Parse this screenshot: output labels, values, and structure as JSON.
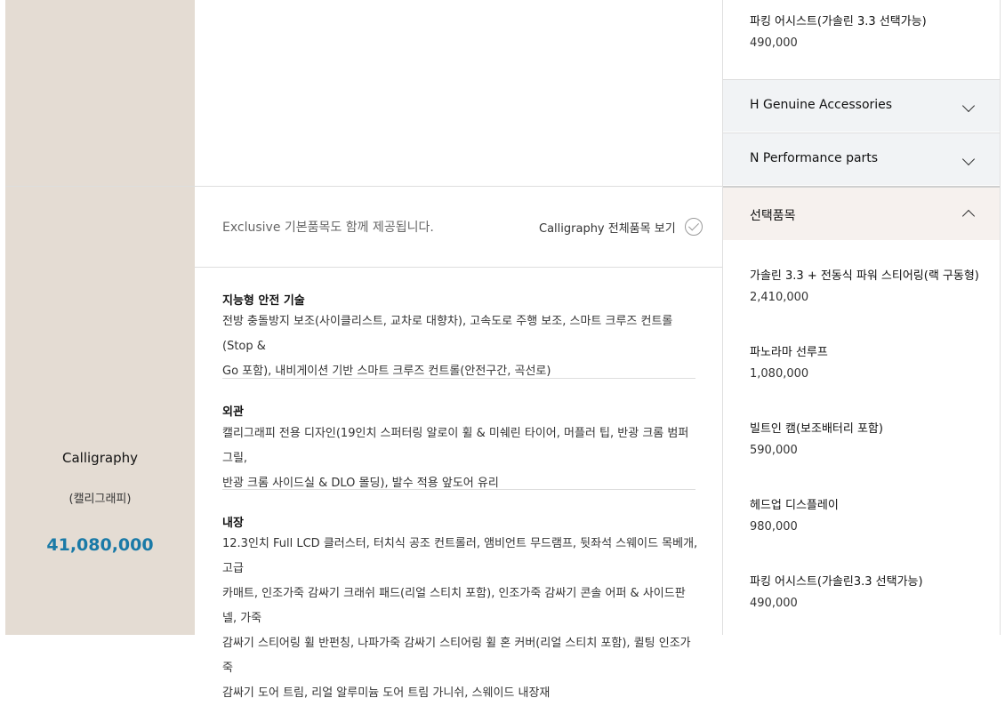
{
  "center": {
    "notice": "Exclusive 기본품목도 함께 제공됩니다.",
    "view_all_label": "Calligraphy 전체품목 보기",
    "categories": [
      {
        "title": "지능형 안전 기술",
        "lines": [
          "전방 충돌방지 보조(사이클리스트, 교차로 대향차), 고속도로 주행 보조, 스마트 크루즈 컨트롤(Stop &",
          "Go 포함), 내비게이션 기반 스마트 크루즈 컨트롤(안전구간, 곡선로)"
        ]
      },
      {
        "title": "외관",
        "lines": [
          "캘리그래피 전용 디자인(19인치 스퍼터링 알로이 휠 & 미쉐린 타이어, 머플러 팁, 반광 크롬 범퍼 그릴,",
          "반광 크롬 사이드실 & DLO 몰딩), 발수 적용 앞도어 유리"
        ]
      },
      {
        "title": "내장",
        "lines": [
          "12.3인치 Full LCD 클러스터, 터치식 공조 컨트롤러, 앰비언트 무드램프, 뒷좌석 스웨이드 목베개, 고급",
          "카매트, 인조가죽 감싸기 크래쉬 패드(리얼 스티치 포함), 인조가죽 감싸기 콘솔 어퍼 & 사이드판넬, 가죽",
          "감싸기 스티어링 휠 반펀칭, 나파가죽 감싸기 스티어링 휠 혼 커버(리얼 스티치 포함), 퀼팅 인조가죽",
          "감싸기 도어 트림, 리얼 알루미늄 도어 트림 가니쉬, 스웨이드 내장재"
        ]
      }
    ]
  },
  "trim": {
    "name": "Calligraphy",
    "subtitle": "(캘리그래피)",
    "price": "41,080,000"
  },
  "right_panel": {
    "top_option": {
      "name": "파킹 어시스트(가솔린 3.3 선택가능)",
      "price": "490,000"
    },
    "accordions": [
      {
        "label": "H Genuine Accessories",
        "expanded": false
      },
      {
        "label": "N Performance parts",
        "expanded": false
      }
    ],
    "selected_section": {
      "label": "선택품목",
      "expanded": true
    },
    "options": [
      {
        "name": "가솔린 3.3 + 전동식 파워 스티어링(랙 구동형)",
        "price": "2,410,000"
      },
      {
        "name": "파노라마 선루프",
        "price": "1,080,000"
      },
      {
        "name": "빌트인 캠(보조배터리 포함)",
        "price": "590,000"
      },
      {
        "name": "헤드업 디스플레이",
        "price": "980,000"
      },
      {
        "name": "파킹 어시스트(가솔린3.3 선택가능)",
        "price": "490,000"
      }
    ]
  },
  "colors": {
    "accent_price": "#1a7aa7",
    "beige": "#e4dcd3",
    "accordion_bg": "#f1f3f5"
  }
}
